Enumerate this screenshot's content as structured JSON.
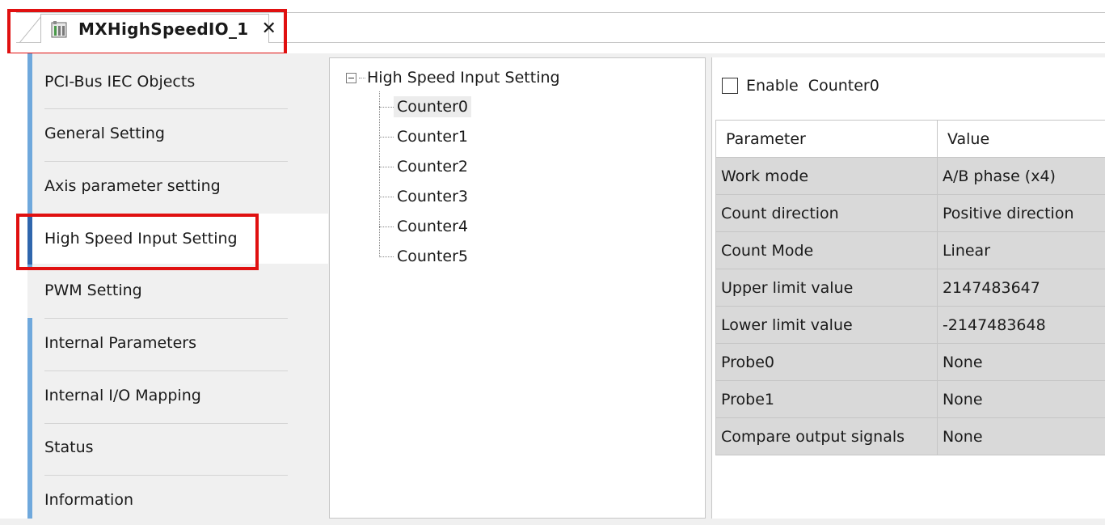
{
  "tab": {
    "title": "MXHighSpeedIO_1",
    "close_symbol": "✕",
    "icon": "device-icon"
  },
  "nav": {
    "items": [
      {
        "label": "PCI-Bus IEC Objects"
      },
      {
        "label": "General Setting"
      },
      {
        "label": "Axis parameter setting"
      },
      {
        "label": "High Speed Input Setting"
      },
      {
        "label": "PWM Setting"
      },
      {
        "label": "Internal Parameters"
      },
      {
        "label": "Internal I/O Mapping"
      },
      {
        "label": "Status"
      },
      {
        "label": "Information"
      }
    ],
    "active_index": 3
  },
  "tree": {
    "root": "High Speed Input Setting",
    "children": [
      "Counter0",
      "Counter1",
      "Counter2",
      "Counter3",
      "Counter4",
      "Counter5"
    ],
    "selected": "Counter0"
  },
  "settings": {
    "enable_label": "Enable  Counter0",
    "enable_checked": false,
    "headers": {
      "parameter": "Parameter",
      "value": "Value"
    },
    "rows": [
      {
        "parameter": "Work mode",
        "value": "A/B phase (x4)"
      },
      {
        "parameter": "Count direction",
        "value": "Positive direction"
      },
      {
        "parameter": "Count Mode",
        "value": "Linear"
      },
      {
        "parameter": "Upper limit value",
        "value": "2147483647"
      },
      {
        "parameter": "Lower limit value",
        "value": "-2147483648"
      },
      {
        "parameter": "Probe0",
        "value": "None"
      },
      {
        "parameter": "Probe1",
        "value": "None"
      },
      {
        "parameter": "Compare output signals",
        "value": "None"
      }
    ]
  },
  "colors": {
    "highlight": "#e01010",
    "nav_accent": "#6fa8dc",
    "nav_active": "#2f66ad",
    "cell_bg": "#d9d9d9"
  }
}
